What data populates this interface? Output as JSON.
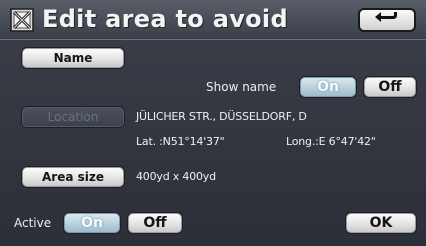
{
  "header": {
    "title": "Edit area to avoid",
    "back_icon": "return-arrow-icon"
  },
  "name_section": {
    "name_button": "Name",
    "show_name_label": "Show name",
    "show_name_on": "On",
    "show_name_off": "Off",
    "show_name_selected": "On"
  },
  "location_section": {
    "location_button": "Location",
    "address": "JÜLICHER STR., DÜSSELDORF, D",
    "lat": "Lat. :N51°14'37\"",
    "long": "Long.:E  6°47'42\""
  },
  "area_section": {
    "area_size_button": "Area size",
    "area_size_value": "400yd x 400yd"
  },
  "footer": {
    "active_label": "Active",
    "active_on": "On",
    "active_off": "Off",
    "active_selected": "On",
    "ok_button": "OK"
  },
  "colors": {
    "background": "#33363f",
    "button_face": "#e4e4e4",
    "selected_toggle": "#b7cfdc"
  }
}
